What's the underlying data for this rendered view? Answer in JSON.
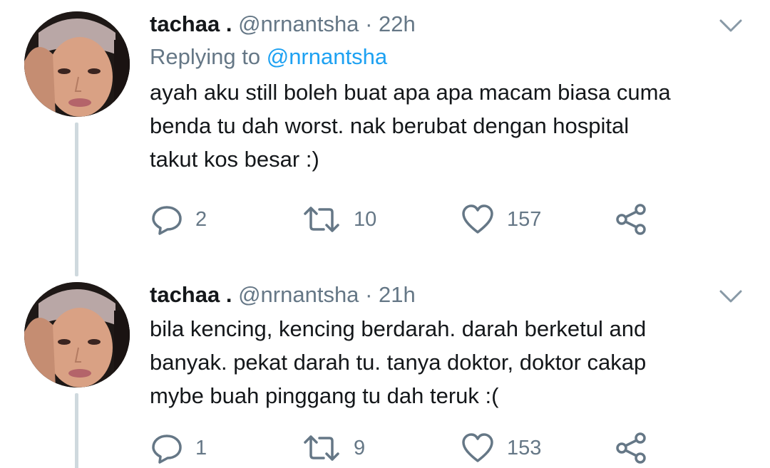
{
  "tweets": [
    {
      "name": "tachaa .",
      "handle": "@nrnantsha",
      "separator": "·",
      "time": "22h",
      "replying_prefix": "Replying to",
      "replying_to": "@nrnantsha",
      "text": "ayah aku still boleh buat apa apa macam biasa cuma\nbenda tu dah worst. nak berubat dengan hospital\ntakut kos besar :)",
      "replies": "2",
      "retweets": "10",
      "likes": "157"
    },
    {
      "name": "tachaa .",
      "handle": "@nrnantsha",
      "separator": "·",
      "time": "21h",
      "text": "bila kencing, kencing berdarah. darah berketul and\nbanyak. pekat darah tu. tanya doktor, doktor cakap\nmybe buah pinggang tu dah teruk :(",
      "replies": "1",
      "retweets": "9",
      "likes": "153"
    }
  ],
  "icons": {
    "reply": "reply-icon",
    "retweet": "retweet-icon",
    "like": "heart-icon",
    "share": "share-icon",
    "caret": "chevron-down-icon"
  },
  "colors": {
    "text": "#14171a",
    "muted": "#657786",
    "link": "#1da1f2",
    "thread_line": "#cfd9de"
  }
}
